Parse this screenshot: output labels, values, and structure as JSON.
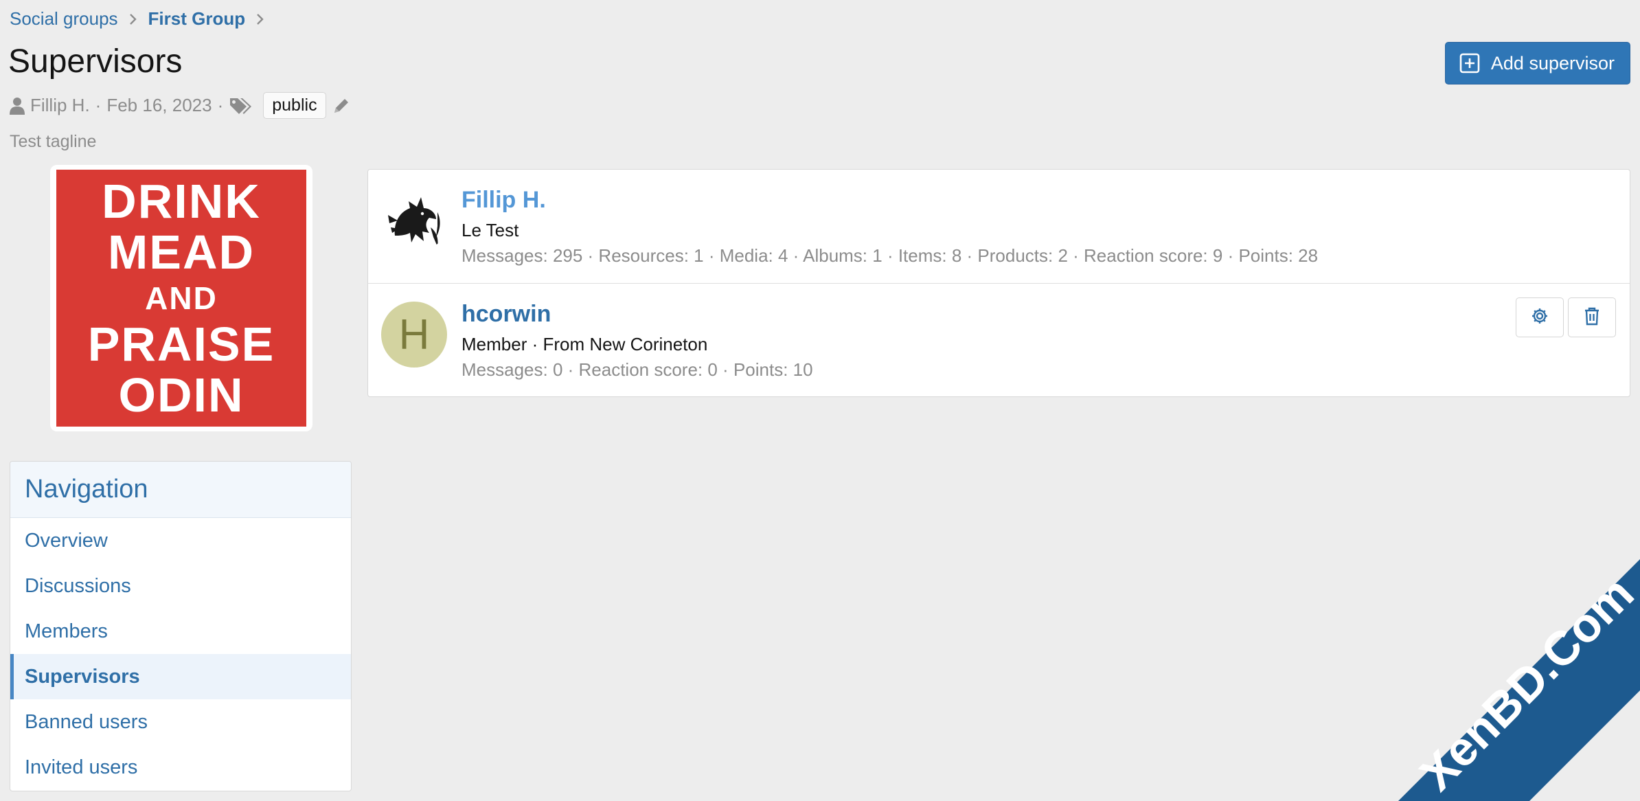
{
  "breadcrumb": {
    "items": [
      {
        "label": "Social groups"
      },
      {
        "label": "First Group"
      }
    ]
  },
  "page": {
    "title": "Supervisors",
    "add_button": "Add supervisor"
  },
  "meta": {
    "author": "Fillip H.",
    "date": "Feb 16, 2023",
    "tag": "public",
    "tagline": "Test tagline"
  },
  "group_image": {
    "lines": [
      "DRINK",
      "MEAD",
      "AND",
      "PRAISE",
      "ODIN"
    ],
    "color": "#d93a34"
  },
  "navigation": {
    "title": "Navigation",
    "items": [
      {
        "label": "Overview"
      },
      {
        "label": "Discussions"
      },
      {
        "label": "Members"
      },
      {
        "label": "Supervisors",
        "active": true
      },
      {
        "label": "Banned users"
      },
      {
        "label": "Invited users"
      }
    ]
  },
  "supervisors": [
    {
      "name": "Fillip H.",
      "title": "Le Test",
      "stats": "Messages: 295 · Resources: 1 · Media: 4 · Albums: 1 · Items: 8 · Products: 2 · Reaction score: 9 · Points: 28",
      "avatar_icon": "dragon-avatar-icon"
    },
    {
      "name": "hcorwin",
      "title": "Member · From New Corineton",
      "stats": "Messages: 0 · Reaction score: 0 · Points: 10",
      "avatar_letter": "H"
    }
  ],
  "watermark": {
    "text": "XenBD.Com",
    "color": "#1d5a8f"
  },
  "colors": {
    "accent": "#2f76b6",
    "link": "#2f6fa7",
    "background": "#ededed"
  }
}
